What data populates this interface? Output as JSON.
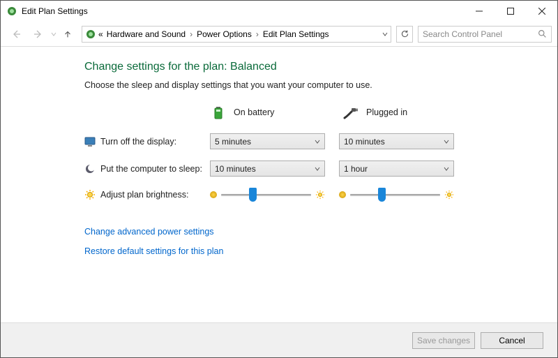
{
  "window": {
    "title": "Edit Plan Settings"
  },
  "breadcrumb": {
    "items": [
      "Hardware and Sound",
      "Power Options",
      "Edit Plan Settings"
    ]
  },
  "search": {
    "placeholder": "Search Control Panel"
  },
  "page": {
    "title": "Change settings for the plan: Balanced",
    "subtitle": "Choose the sleep and display settings that you want your computer to use."
  },
  "columns": {
    "battery": "On battery",
    "plugged": "Plugged in"
  },
  "rows": {
    "display": {
      "label": "Turn off the display:",
      "battery": "5 minutes",
      "plugged": "10 minutes"
    },
    "sleep": {
      "label": "Put the computer to sleep:",
      "battery": "10 minutes",
      "plugged": "1 hour"
    },
    "brightness": {
      "label": "Adjust plan brightness:"
    }
  },
  "links": {
    "advanced": "Change advanced power settings",
    "restore": "Restore default settings for this plan"
  },
  "buttons": {
    "save": "Save changes",
    "cancel": "Cancel"
  }
}
